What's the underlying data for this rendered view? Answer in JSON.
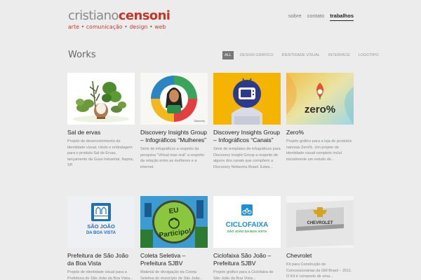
{
  "header": {
    "logo_part1": "cristiano",
    "logo_part2": "censoni",
    "tagline": "arte • comunicação • design • web",
    "nav": [
      {
        "label": "sobre"
      },
      {
        "label": "contato"
      },
      {
        "label": "trabalhos"
      }
    ]
  },
  "main": {
    "title": "Works",
    "filters": [
      "ALL",
      "DESIGN GRÁFICO",
      "IDENTIDADE VISUAL",
      "INTERFACE",
      "LOGOTIPO"
    ]
  },
  "works": [
    {
      "title": "Sal de ervas",
      "desc": "Projeto de desenvolvimento de identidade visual, rótulo e embalagem para o produto Sal de Ervas, lançamento da Guss Industrial, Itapira, SP."
    },
    {
      "title": "Discovery Insights Group – Infográficos “Mulheres”",
      "desc": "Série de infográficos a respeito da pesquisa “Virtual mas real” a respeito da relação entre as mulheres e a internet.",
      "badge": "Discovery"
    },
    {
      "title": "Discovery Insights Group – Infográficos “Canais”",
      "desc": "Série de templates de infográficos para Discovery Insight Group a respeito de alguns dos canais que compõem a Discovery Networks Brasil. Estes..."
    },
    {
      "title": "Zero%",
      "desc": "Projeto gráfico para a loja de produtos naturais Zero%. Um projeto de identidade visual completo incluí inicialmente um estudo de...",
      "logo": "zero%"
    },
    {
      "title": "Prefeitura de São João da Boa Vista",
      "desc": "Projeto de identidade visual para a Prefeitura de São João da Boa Vista...",
      "logo_line1": "SÃO JOÃO",
      "logo_line2": "DA BOA VISTA"
    },
    {
      "title": "Coleta Seletiva – Prefeitura SJBV",
      "desc": "Material de divulgação da Coleta Seletiva do município de São João...",
      "sign_line1": "EU",
      "sign_line2": "Participo!"
    },
    {
      "title": "Ciclofaixa São João – Prefeitura SJBV",
      "desc": "Projeto gráfico para a Ciclofaixa de São João da Boa Vista...",
      "logo_line1": "CICLOFAIXA",
      "logo_line2": "SÃO JOÃO DA BOA VISTA"
    },
    {
      "title": "Chevrolet",
      "desc": "Kit para Construção de Concessionárias da GM Brasil – 2011. O Kit é composto de uma...",
      "brand": "CHEVROLET"
    }
  ]
}
